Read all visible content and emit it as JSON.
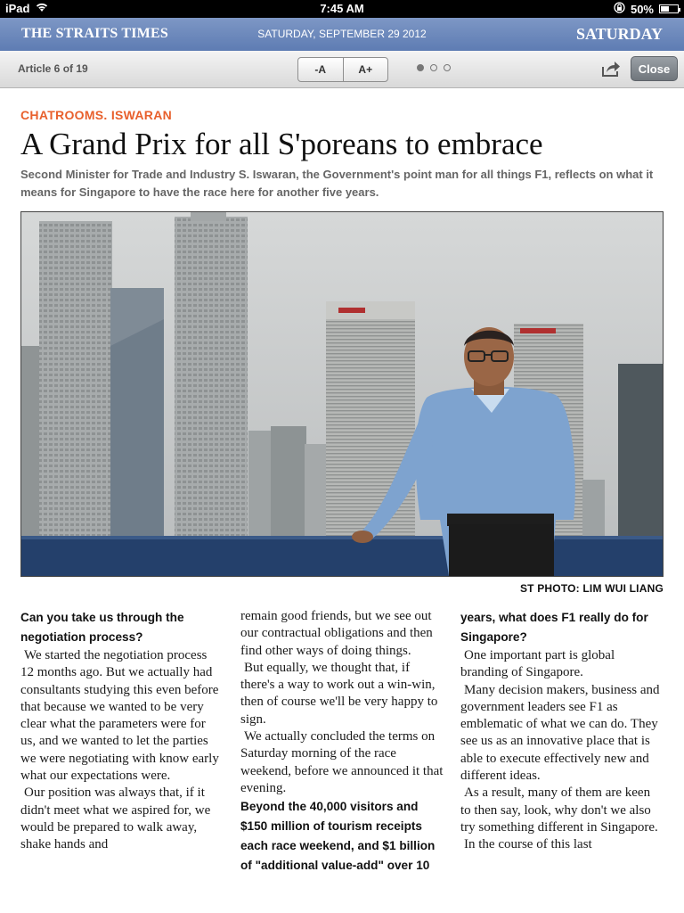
{
  "status_bar": {
    "device": "iPad",
    "time": "7:45 AM",
    "battery": "50%",
    "battery_level": 0.5
  },
  "masthead": {
    "brand": "THE STRAITS TIMES",
    "date": "SATURDAY, SEPTEMBER 29 2012",
    "day": "SATURDAY"
  },
  "toolbar": {
    "article_count": "Article 6 of 19",
    "font_decrease": "-A",
    "font_increase": "A+",
    "page_dots": 3,
    "active_page_dot": 1,
    "close_label": "Close"
  },
  "article": {
    "kicker": "CHATROOMS. ISWARAN",
    "headline": "A Grand Prix for all S'poreans to embrace",
    "standfirst": "Second Minister for Trade and Industry S. Iswaran, the Government's point man for all things F1, reflects on what it means for Singapore to have the race here for another five years.",
    "photo_credit": "ST PHOTO: LIM WUI LIANG",
    "col1": {
      "q1": "Can you take us through the negotiation process?",
      "p1": "We started the negotiation process 12 months ago. But we actually had consultants studying this even before that because we wanted to be very clear what the parameters were for us, and we wanted to let the parties we were negotiating with know early what our expectations were.",
      "p2": "Our position was always that, if it didn't meet what we aspired for, we would be prepared to walk away, shake hands and"
    },
    "col2": {
      "p1": "remain good friends, but we see out our contractual obligations and then find other ways of doing things.",
      "p2": "But equally, we thought that, if there's a way to work out a win-win, then of course we'll be very happy to sign.",
      "p3": "We actually concluded the terms on Saturday morning of the race weekend, before we announced it that evening.",
      "q2": "Beyond the 40,000 visitors and $150 million of tourism receipts each race weekend, and $1 billion of \"additional value-add\" over 10"
    },
    "col3": {
      "q2_cont": "years, what does F1 really do for Singapore?",
      "p1": "One important part is global branding of Singapore.",
      "p2": "Many decision makers, business and government leaders see F1 as emblematic of what we can do. They see us as an innovative place that is able to execute effectively new and different ideas.",
      "p3": "As a result, many of them are keen to then say, look, why don't we also try something different in Singapore.",
      "p4": "In the course of this last"
    }
  },
  "colors": {
    "masthead": "#6a86bb",
    "kicker": "#e8602c",
    "standfirst": "#666666"
  }
}
